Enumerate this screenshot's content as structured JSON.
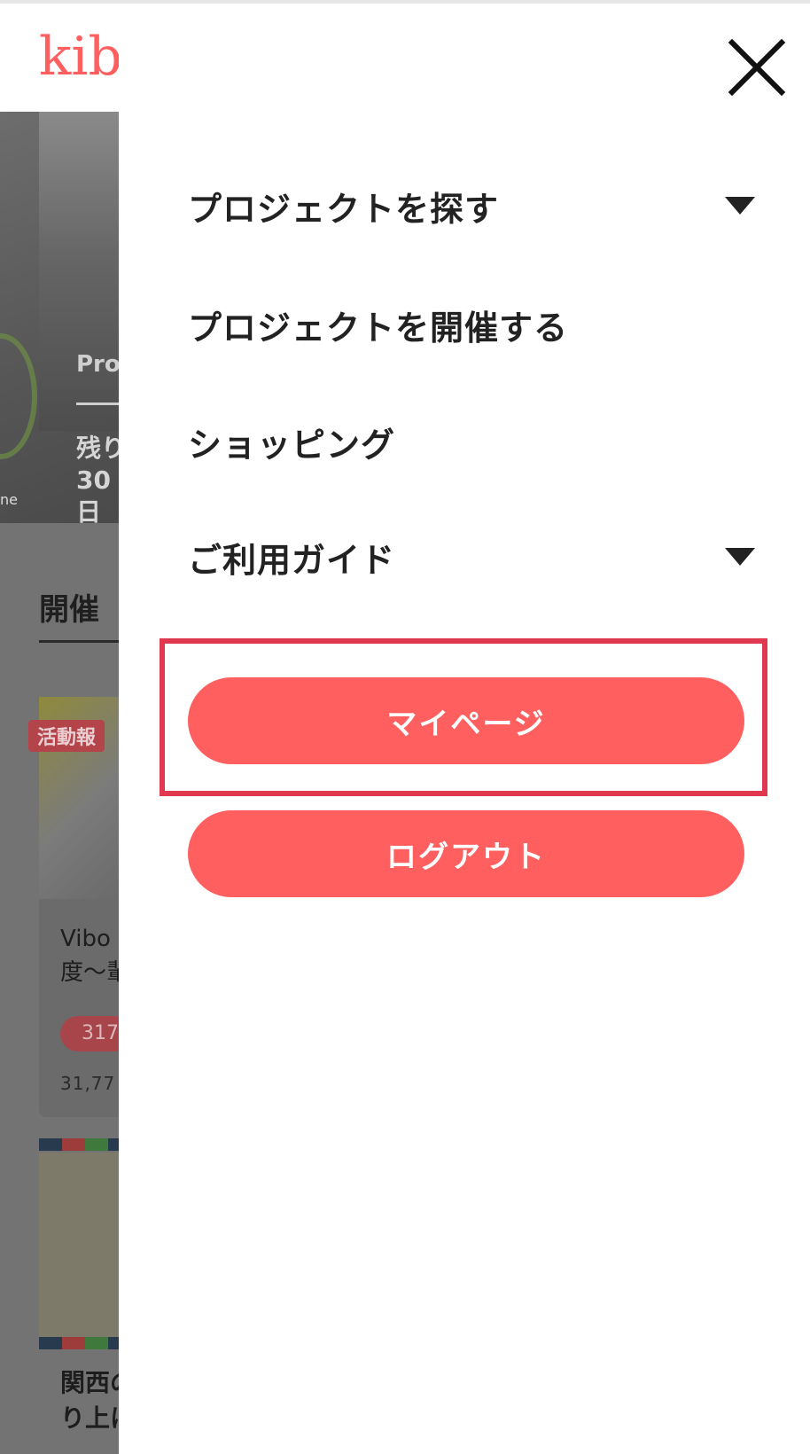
{
  "background_page": {
    "logo_text": "kib",
    "hero_label": "Pro",
    "hero_text": "残り30日",
    "hero_small": "ne",
    "section_title": "開催",
    "badge": "活動報",
    "card1_title_line1": "Vibo",
    "card1_title_line2": "度〜輩",
    "card1_pill": "317",
    "card1_amount": "31,77",
    "card2_title_line1": "関西の",
    "card2_title_line2": "り上に"
  },
  "drawer": {
    "close_icon": "close-icon",
    "menu_items": [
      {
        "label": "プロジェクトを探す",
        "has_dropdown": true
      },
      {
        "label": "プロジェクトを開催する",
        "has_dropdown": false
      },
      {
        "label": "ショッピング",
        "has_dropdown": false
      },
      {
        "label": "ご利用ガイド",
        "has_dropdown": true
      }
    ],
    "mypage_button": "マイページ",
    "logout_button": "ログアウト"
  },
  "colors": {
    "brand": "#ff5f5f",
    "highlight": "#e0384e",
    "text": "#222222"
  }
}
